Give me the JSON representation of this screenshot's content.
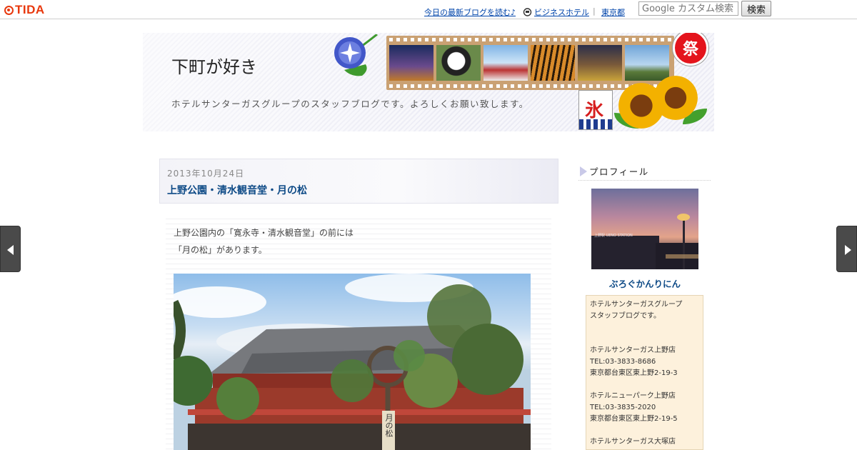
{
  "topbar": {
    "logo_text": "TIDA",
    "link_today": "今日の最新ブログを読む♪",
    "link_hotel": "ビジネスホテル",
    "separator": "|",
    "link_tokyo": "東京都",
    "search_placeholder": "Google カスタム検索",
    "search_button": "検索",
    "accent_color": "#e8380d"
  },
  "header": {
    "title": "下町が好き",
    "description": "ホテルサンターガスグループのスタッフブログです。よろしくお願い致します。",
    "lantern_text": "祭",
    "kori_text": "氷"
  },
  "post": {
    "date": "2013年10月24日",
    "title": "上野公園・清水観音堂・月の松",
    "body_lines": [
      "上野公園内の「寛永寺・清水観音堂」の前には",
      "「月の松」があります。"
    ],
    "photo_sign": "月の松"
  },
  "sidebar": {
    "profile_heading": "プロフィール",
    "avatar_sign": "上野駅 UENO STATION",
    "nickname": "ぶろぐかんりにん",
    "profile_lines": [
      "ホテルサンターガスグループ",
      "スタッフブログです。",
      "",
      "",
      "ホテルサンターガス上野店",
      "TEL:03-3833-8686",
      "東京都台東区東上野2-19-3",
      "",
      "ホテルニューパーク上野店",
      "TEL:03-3835-2020",
      "東京都台東区東上野2-19-5",
      "",
      "ホテルサンターガス大塚店"
    ]
  }
}
